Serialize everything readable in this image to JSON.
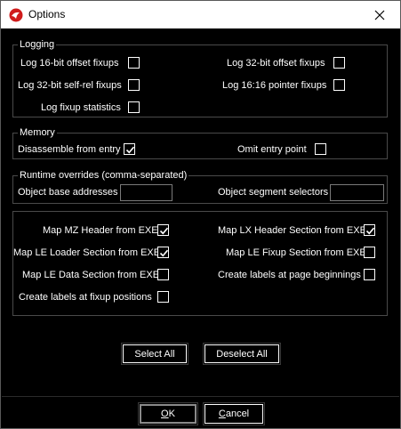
{
  "window": {
    "title": "Options",
    "close_icon": "close-icon",
    "app_icon": "red-circle-app-icon",
    "accent_color": "#d01c1c"
  },
  "logging": {
    "legend": "Logging",
    "log_16bit_offset": {
      "label": "Log 16-bit offset fixups",
      "checked": false
    },
    "log_32bit_offset": {
      "label": "Log 32-bit offset fixups",
      "checked": false
    },
    "log_32bit_selfrel": {
      "label": "Log 32-bit self-rel fixups",
      "checked": false
    },
    "log_1616_pointer": {
      "label": "Log 16:16 pointer fixups",
      "checked": false
    },
    "log_fixup_stats": {
      "label": "Log fixup statistics",
      "checked": false
    }
  },
  "memory": {
    "legend": "Memory",
    "disassemble_entry": {
      "label": "Disassemble from entry",
      "checked": true
    },
    "omit_entry": {
      "label": "Omit entry point",
      "checked": false
    }
  },
  "runtime": {
    "legend": "Runtime overrides (comma-separated)",
    "base_addresses": {
      "label": "Object base addresses",
      "value": ""
    },
    "segment_selectors": {
      "label": "Object segment selectors",
      "value": ""
    }
  },
  "mapping": {
    "mz_header": {
      "label": "Map MZ Header from EXE",
      "checked": true
    },
    "lx_header": {
      "label": "Map LX Header Section from EXE",
      "checked": true
    },
    "le_loader": {
      "label": "Map LE Loader Section from EXE",
      "checked": true
    },
    "le_fixup": {
      "label": "Map LE Fixup Section from EXE",
      "checked": false
    },
    "le_data": {
      "label": "Map LE Data Section from EXE",
      "checked": false
    },
    "labels_page": {
      "label": "Create labels at page beginnings",
      "checked": false
    },
    "labels_fixup": {
      "label": "Create labels at fixup positions",
      "checked": false
    }
  },
  "actions": {
    "select_all": "Select All",
    "deselect_all": "Deselect All"
  },
  "footer": {
    "ok_rest": "K",
    "ok_key": "O",
    "cancel_key": "C",
    "cancel_rest": "ancel"
  }
}
